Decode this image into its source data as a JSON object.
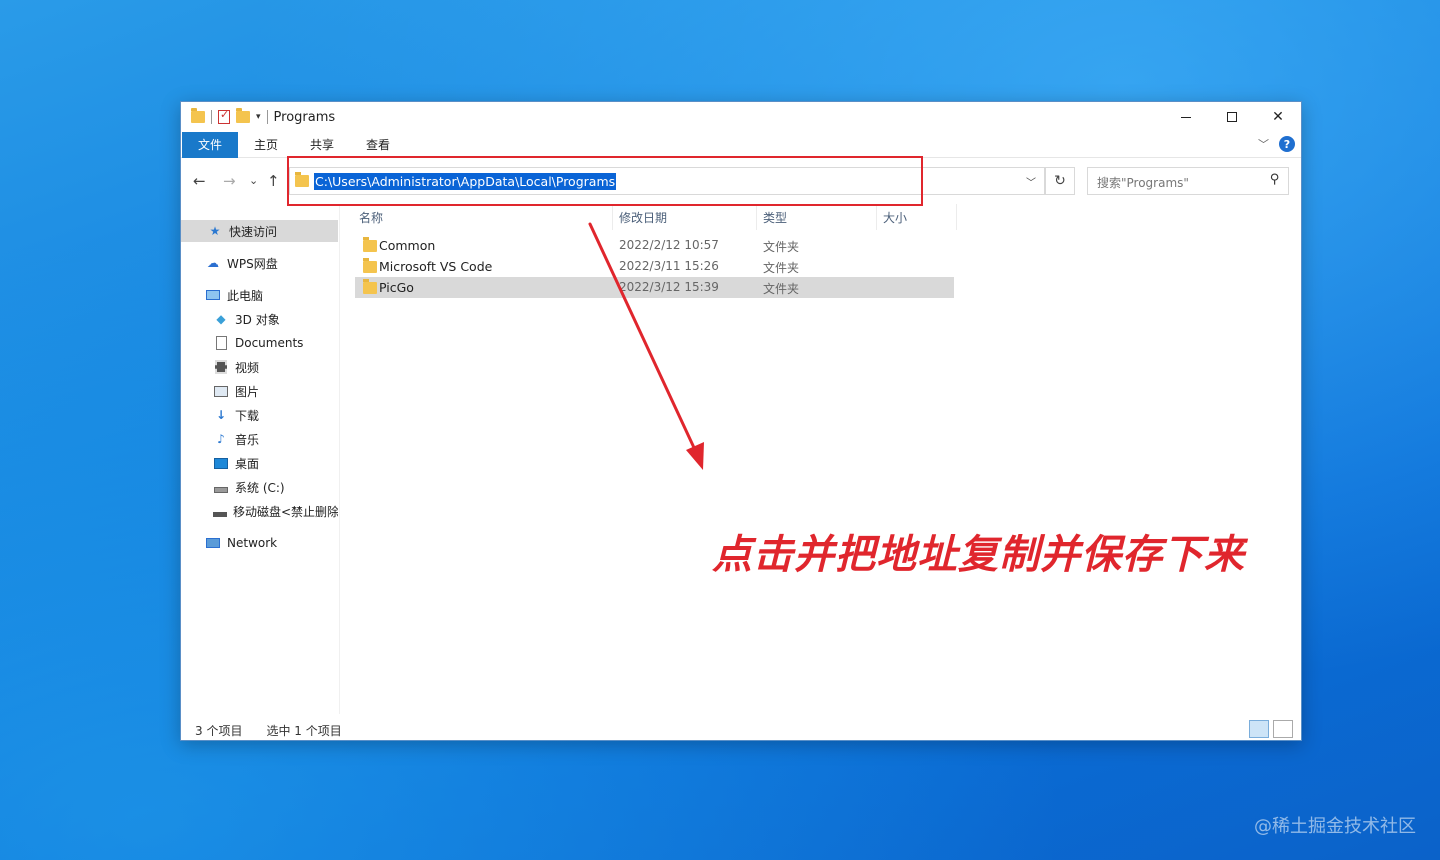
{
  "window": {
    "title": "Programs",
    "controls": {
      "minimize": "—",
      "maximize": "☐",
      "close": "✕"
    }
  },
  "ribbon": {
    "tabs": [
      {
        "label": "文件",
        "active": true
      },
      {
        "label": "主页",
        "active": false
      },
      {
        "label": "共享",
        "active": false
      },
      {
        "label": "查看",
        "active": false
      }
    ],
    "help": "?"
  },
  "nav": {
    "back": "←",
    "forward": "→",
    "recent": "⌄",
    "up": "↑",
    "address": "C:\\Users\\Administrator\\AppData\\Local\\Programs",
    "refresh": "↻",
    "search_placeholder": "搜索\"Programs\""
  },
  "sidebar": {
    "items": [
      {
        "label": "快速访问",
        "icon": "quick-access-star-icon"
      },
      {
        "label": "WPS网盘",
        "icon": "cloud-icon"
      },
      {
        "label": "此电脑",
        "icon": "computer-icon"
      },
      {
        "label": "3D 对象",
        "icon": "cube-icon"
      },
      {
        "label": "Documents",
        "icon": "document-icon"
      },
      {
        "label": "视频",
        "icon": "film-icon"
      },
      {
        "label": "图片",
        "icon": "picture-icon"
      },
      {
        "label": "下载",
        "icon": "download-arrow-icon"
      },
      {
        "label": "音乐",
        "icon": "music-note-icon"
      },
      {
        "label": "桌面",
        "icon": "desktop-icon"
      },
      {
        "label": "系统 (C:)",
        "icon": "drive-icon"
      },
      {
        "label": "移动磁盘<禁止删除",
        "icon": "removable-drive-icon"
      },
      {
        "label": "Network",
        "icon": "network-icon"
      }
    ]
  },
  "files": {
    "columns": [
      "名称",
      "修改日期",
      "类型",
      "大小"
    ],
    "rows": [
      {
        "name": "Common",
        "date": "2022/2/12 10:57",
        "type": "文件夹",
        "size": "",
        "selected": false
      },
      {
        "name": "Microsoft VS Code",
        "date": "2022/3/11 15:26",
        "type": "文件夹",
        "size": "",
        "selected": false
      },
      {
        "name": "PicGo",
        "date": "2022/3/12 15:39",
        "type": "文件夹",
        "size": "",
        "selected": true
      }
    ]
  },
  "status": {
    "count": "3 个项目",
    "selected": "选中 1 个项目"
  },
  "annotation": {
    "caption": "点击并把地址复制并保存下来",
    "color": "#e0262d"
  },
  "watermark": "@稀土掘金技术社区"
}
